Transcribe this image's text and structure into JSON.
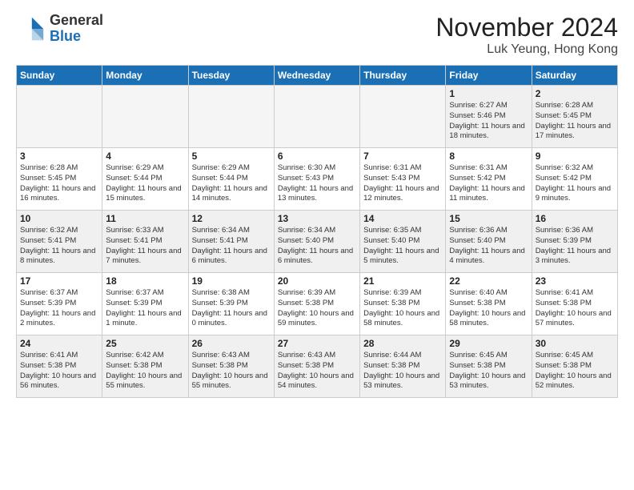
{
  "header": {
    "logo_general": "General",
    "logo_blue": "Blue",
    "month_title": "November 2024",
    "location": "Luk Yeung, Hong Kong"
  },
  "days_of_week": [
    "Sunday",
    "Monday",
    "Tuesday",
    "Wednesday",
    "Thursday",
    "Friday",
    "Saturday"
  ],
  "weeks": [
    [
      {
        "day": "",
        "empty": true
      },
      {
        "day": "",
        "empty": true
      },
      {
        "day": "",
        "empty": true
      },
      {
        "day": "",
        "empty": true
      },
      {
        "day": "",
        "empty": true
      },
      {
        "day": "1",
        "sunrise": "6:27 AM",
        "sunset": "5:46 PM",
        "daylight": "11 hours and 18 minutes."
      },
      {
        "day": "2",
        "sunrise": "6:28 AM",
        "sunset": "5:45 PM",
        "daylight": "11 hours and 17 minutes."
      }
    ],
    [
      {
        "day": "3",
        "sunrise": "6:28 AM",
        "sunset": "5:45 PM",
        "daylight": "11 hours and 16 minutes."
      },
      {
        "day": "4",
        "sunrise": "6:29 AM",
        "sunset": "5:44 PM",
        "daylight": "11 hours and 15 minutes."
      },
      {
        "day": "5",
        "sunrise": "6:29 AM",
        "sunset": "5:44 PM",
        "daylight": "11 hours and 14 minutes."
      },
      {
        "day": "6",
        "sunrise": "6:30 AM",
        "sunset": "5:43 PM",
        "daylight": "11 hours and 13 minutes."
      },
      {
        "day": "7",
        "sunrise": "6:31 AM",
        "sunset": "5:43 PM",
        "daylight": "11 hours and 12 minutes."
      },
      {
        "day": "8",
        "sunrise": "6:31 AM",
        "sunset": "5:42 PM",
        "daylight": "11 hours and 11 minutes."
      },
      {
        "day": "9",
        "sunrise": "6:32 AM",
        "sunset": "5:42 PM",
        "daylight": "11 hours and 9 minutes."
      }
    ],
    [
      {
        "day": "10",
        "sunrise": "6:32 AM",
        "sunset": "5:41 PM",
        "daylight": "11 hours and 8 minutes."
      },
      {
        "day": "11",
        "sunrise": "6:33 AM",
        "sunset": "5:41 PM",
        "daylight": "11 hours and 7 minutes."
      },
      {
        "day": "12",
        "sunrise": "6:34 AM",
        "sunset": "5:41 PM",
        "daylight": "11 hours and 6 minutes."
      },
      {
        "day": "13",
        "sunrise": "6:34 AM",
        "sunset": "5:40 PM",
        "daylight": "11 hours and 6 minutes."
      },
      {
        "day": "14",
        "sunrise": "6:35 AM",
        "sunset": "5:40 PM",
        "daylight": "11 hours and 5 minutes."
      },
      {
        "day": "15",
        "sunrise": "6:36 AM",
        "sunset": "5:40 PM",
        "daylight": "11 hours and 4 minutes."
      },
      {
        "day": "16",
        "sunrise": "6:36 AM",
        "sunset": "5:39 PM",
        "daylight": "11 hours and 3 minutes."
      }
    ],
    [
      {
        "day": "17",
        "sunrise": "6:37 AM",
        "sunset": "5:39 PM",
        "daylight": "11 hours and 2 minutes."
      },
      {
        "day": "18",
        "sunrise": "6:37 AM",
        "sunset": "5:39 PM",
        "daylight": "11 hours and 1 minute."
      },
      {
        "day": "19",
        "sunrise": "6:38 AM",
        "sunset": "5:39 PM",
        "daylight": "11 hours and 0 minutes."
      },
      {
        "day": "20",
        "sunrise": "6:39 AM",
        "sunset": "5:38 PM",
        "daylight": "10 hours and 59 minutes."
      },
      {
        "day": "21",
        "sunrise": "6:39 AM",
        "sunset": "5:38 PM",
        "daylight": "10 hours and 58 minutes."
      },
      {
        "day": "22",
        "sunrise": "6:40 AM",
        "sunset": "5:38 PM",
        "daylight": "10 hours and 58 minutes."
      },
      {
        "day": "23",
        "sunrise": "6:41 AM",
        "sunset": "5:38 PM",
        "daylight": "10 hours and 57 minutes."
      }
    ],
    [
      {
        "day": "24",
        "sunrise": "6:41 AM",
        "sunset": "5:38 PM",
        "daylight": "10 hours and 56 minutes."
      },
      {
        "day": "25",
        "sunrise": "6:42 AM",
        "sunset": "5:38 PM",
        "daylight": "10 hours and 55 minutes."
      },
      {
        "day": "26",
        "sunrise": "6:43 AM",
        "sunset": "5:38 PM",
        "daylight": "10 hours and 55 minutes."
      },
      {
        "day": "27",
        "sunrise": "6:43 AM",
        "sunset": "5:38 PM",
        "daylight": "10 hours and 54 minutes."
      },
      {
        "day": "28",
        "sunrise": "6:44 AM",
        "sunset": "5:38 PM",
        "daylight": "10 hours and 53 minutes."
      },
      {
        "day": "29",
        "sunrise": "6:45 AM",
        "sunset": "5:38 PM",
        "daylight": "10 hours and 53 minutes."
      },
      {
        "day": "30",
        "sunrise": "6:45 AM",
        "sunset": "5:38 PM",
        "daylight": "10 hours and 52 minutes."
      }
    ]
  ],
  "colors": {
    "header_bg": "#1a6fb5",
    "shaded_row": "#f0f0f0",
    "empty_cell": "#f5f5f5"
  }
}
